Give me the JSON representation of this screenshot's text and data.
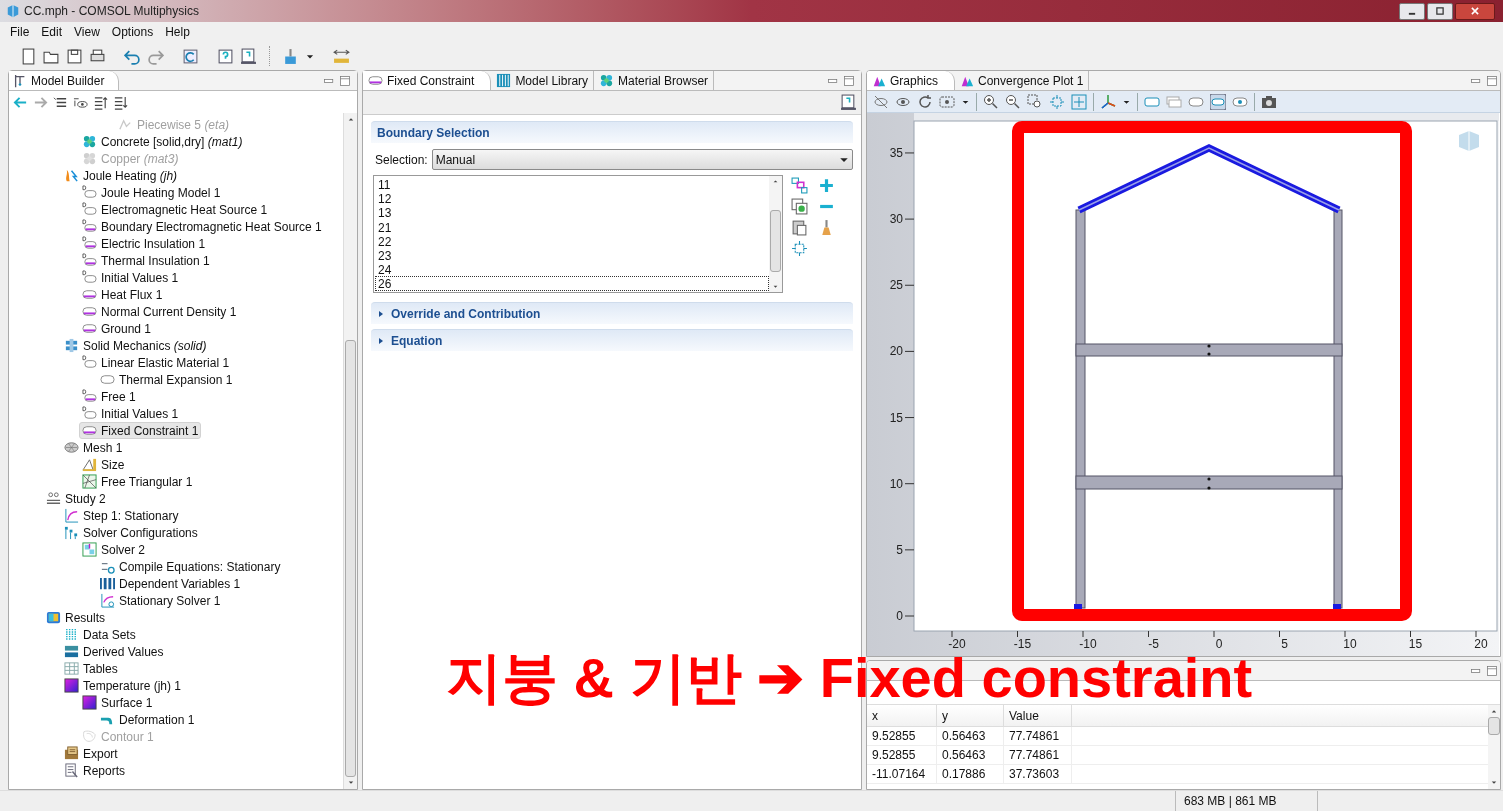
{
  "window": {
    "title": "CC.mph - COMSOL Multiphysics"
  },
  "menu": [
    "File",
    "Edit",
    "View",
    "Options",
    "Help"
  ],
  "model_builder": {
    "title": "Model Builder",
    "tree": [
      {
        "children": [
          {
            "children": [
              {
                "children": [
                  {
                    "children": [
                      {
                        "label": "Piecewise 5 *(eta)*",
                        "kind": "function",
                        "selected": false,
                        "disabled": true
                      }
                    ]
                  }
                ]
              },
              {
                "label": "Concrete [solid,dry] *(mat1)*",
                "kind": "material",
                "selected": false,
                "disabled": false
              },
              {
                "label": "Copper *(mat3)*",
                "kind": "material",
                "selected": false,
                "disabled": true
              }
            ]
          },
          {
            "label": "Joule Heating *(jh)*",
            "kind": "joule",
            "selected": false,
            "disabled": false,
            "children": [
              {
                "label": "Joule Heating Model 1",
                "kind": "default_domain",
                "selected": false,
                "disabled": false
              },
              {
                "label": "Electromagnetic Heat Source 1",
                "kind": "default_domain",
                "selected": false,
                "disabled": false
              },
              {
                "label": "Boundary Electromagnetic Heat Source 1",
                "kind": "default_boundary",
                "selected": false,
                "disabled": false
              },
              {
                "label": "Electric Insulation 1",
                "kind": "default_boundary",
                "selected": false,
                "disabled": false
              },
              {
                "label": "Thermal Insulation 1",
                "kind": "default_boundary",
                "selected": false,
                "disabled": false
              },
              {
                "label": "Initial Values 1",
                "kind": "default_domain",
                "selected": false,
                "disabled": false
              },
              {
                "label": "Heat Flux 1",
                "kind": "boundary",
                "selected": false,
                "disabled": false
              },
              {
                "label": "Normal Current Density 1",
                "kind": "boundary",
                "selected": false,
                "disabled": false
              },
              {
                "label": "Ground 1",
                "kind": "boundary",
                "selected": false,
                "disabled": false
              }
            ]
          },
          {
            "label": "Solid Mechanics *(solid)*",
            "kind": "solid",
            "selected": false,
            "disabled": false,
            "children": [
              {
                "label": "Linear Elastic Material 1",
                "kind": "default_domain",
                "selected": false,
                "disabled": false,
                "children": [
                  {
                    "label": "Thermal Expansion 1",
                    "kind": "subnode",
                    "selected": false,
                    "disabled": false
                  }
                ]
              },
              {
                "label": "Free 1",
                "kind": "default_boundary",
                "selected": false,
                "disabled": false
              },
              {
                "label": "Initial Values 1",
                "kind": "default_domain",
                "selected": false,
                "disabled": false
              },
              {
                "label": "Fixed Constraint 1",
                "kind": "boundary",
                "selected": true,
                "disabled": false
              }
            ]
          },
          {
            "label": "Mesh 1",
            "kind": "mesh",
            "selected": false,
            "disabled": false,
            "children": [
              {
                "label": "Size",
                "kind": "size",
                "selected": false,
                "disabled": false
              },
              {
                "label": "Free Triangular 1",
                "kind": "triangular",
                "selected": false,
                "disabled": false
              }
            ]
          }
        ]
      },
      {
        "label": "Study 2",
        "kind": "study",
        "selected": false,
        "disabled": false,
        "children": [
          {
            "label": "Step 1: Stationary",
            "kind": "step",
            "selected": false,
            "disabled": false
          },
          {
            "label": "Solver Configurations",
            "kind": "solver_config",
            "selected": false,
            "disabled": false,
            "children": [
              {
                "label": "Solver 2",
                "kind": "solver",
                "selected": false,
                "disabled": false,
                "children": [
                  {
                    "label": "Compile Equations: Stationary",
                    "kind": "compile",
                    "selected": false,
                    "disabled": false
                  },
                  {
                    "label": "Dependent Variables 1",
                    "kind": "variables",
                    "selected": false,
                    "disabled": false
                  },
                  {
                    "label": "Stationary Solver 1",
                    "kind": "stationary",
                    "selected": false,
                    "disabled": false
                  }
                ]
              }
            ]
          }
        ]
      },
      {
        "label": "Results",
        "kind": "results",
        "selected": false,
        "disabled": false,
        "children": [
          {
            "label": "Data Sets",
            "kind": "datasets",
            "selected": false,
            "disabled": false
          },
          {
            "label": "Derived Values",
            "kind": "derived",
            "selected": false,
            "disabled": false
          },
          {
            "label": "Tables",
            "kind": "tables",
            "selected": false,
            "disabled": false
          },
          {
            "label": "Temperature (jh) 1",
            "kind": "plot",
            "selected": false,
            "disabled": false,
            "children": [
              {
                "label": "Surface 1",
                "kind": "plot",
                "selected": false,
                "disabled": false,
                "children": [
                  {
                    "label": "Deformation 1",
                    "kind": "deformation",
                    "selected": false,
                    "disabled": false
                  }
                ]
              },
              {
                "label": "Contour 1",
                "kind": "contour",
                "selected": false,
                "disabled": true
              }
            ]
          },
          {
            "label": "Export",
            "kind": "export",
            "selected": false,
            "disabled": false
          },
          {
            "label": "Reports",
            "kind": "reports",
            "selected": false,
            "disabled": false
          }
        ]
      }
    ]
  },
  "settings": {
    "tabs": [
      {
        "label": "Fixed Constraint",
        "kind": "boundary",
        "selected": true
      },
      {
        "label": "Model Library",
        "kind": "library",
        "selected": false
      },
      {
        "label": "Material Browser",
        "kind": "material",
        "selected": false
      }
    ],
    "sections": [
      {
        "title": "Boundary Selection",
        "expanded": true,
        "selection": {
          "label": "Selection:",
          "value": "Manual",
          "items": [
            {
              "label": "11",
              "focused": false
            },
            {
              "label": "12",
              "focused": false
            },
            {
              "label": "13",
              "focused": false
            },
            {
              "label": "21",
              "focused": false
            },
            {
              "label": "22",
              "focused": false
            },
            {
              "label": "23",
              "focused": false
            },
            {
              "label": "24",
              "focused": false
            },
            {
              "label": "26",
              "focused": true
            }
          ]
        }
      },
      {
        "title": "Override and Contribution",
        "expanded": false
      },
      {
        "title": "Equation",
        "expanded": false
      }
    ]
  },
  "graphics": {
    "tabs": [
      {
        "label": "Graphics",
        "selected": true
      },
      {
        "label": "Convergence Plot 1",
        "selected": false
      }
    ],
    "y_ticks": [
      "35",
      "30",
      "25",
      "20",
      "15",
      "10",
      "5",
      "0"
    ],
    "x_ticks": [
      "-20",
      "-15",
      "-10",
      "-5",
      "0",
      "5",
      "10",
      "15",
      "20"
    ]
  },
  "results_table": {
    "columns": [
      "x",
      "y",
      "Value"
    ],
    "rows": [
      [
        "9.52855",
        "0.56463",
        "77.74861"
      ],
      [
        "9.52855",
        "0.56463",
        "77.74861"
      ],
      [
        "-11.07164",
        "0.17886",
        "37.73603"
      ]
    ]
  },
  "annotation": {
    "text": "지붕 & 기반 ➔ Fixed constraint"
  },
  "status_bar": {
    "memory": "683 MB | 861 MB"
  }
}
